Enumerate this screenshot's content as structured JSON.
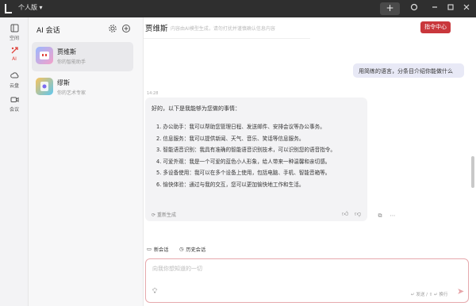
{
  "window": {
    "workspace_label": "个人版 ▾"
  },
  "titlebar": {
    "plus": "+",
    "icons": [
      "sync-icon",
      "minimize-icon",
      "maximize-icon",
      "close-icon"
    ]
  },
  "rail": {
    "items": [
      {
        "label": "空间",
        "icon": "space-icon",
        "active": false
      },
      {
        "label": "AI",
        "icon": "ai-icon",
        "active": true
      },
      {
        "label": "云盘",
        "icon": "cloud-icon",
        "active": false
      },
      {
        "label": "会议",
        "icon": "meeting-icon",
        "active": false
      }
    ]
  },
  "sidebar": {
    "title": "AI 会话",
    "agents": [
      {
        "name": "贾维斯",
        "subtitle": "你的智能助手",
        "selected": true
      },
      {
        "name": "缪斯",
        "subtitle": "你的艺术专家",
        "selected": false
      }
    ]
  },
  "chat": {
    "title": "贾维斯",
    "description": "内容由AI模型生成，请勿打扰并谨慎确认信息内容",
    "command_button": "指令中心",
    "user_message": "用简练的语言，分条目介绍你能做什么",
    "timestamp": "14:28",
    "bot_intro": "好的，以下是我能够为您做的事情：",
    "bot_items": [
      "1. 办公助手：我可以帮助您管理日程、发送邮件、安排会议等办公事务。",
      "2. 信息服务：我可以提供新闻、天气、音乐、笑话等信息服务。",
      "3. 智能语音识别：我具有准确的智能语音识别技术，可以识别您的语音指令。",
      "4. 可爱外观：我是一个可爱的蓝色小人形象，给人带来一种温馨和亲切感。",
      "5. 多设备使用：我可以在多个设备上使用，包括电脑、手机、智能音箱等。",
      "6. 愉快体验：通过与我的交互，您可以更加愉快地工作和生活。"
    ],
    "regenerate": "重新生成",
    "new_session": "新会话",
    "history": "历史会话",
    "input_placeholder": "向我你想知道的一切",
    "send_hint": "↵ 发送 / ⇧ ↵ 换行"
  },
  "colors": {
    "accent": "#c9373c",
    "user_bubble": "#e8e9f6",
    "bot_bubble": "#f3f3f5",
    "titlebar": "#2f2f2f"
  }
}
